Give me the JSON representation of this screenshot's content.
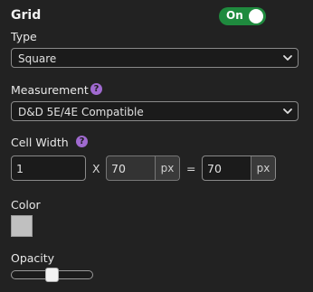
{
  "grid": {
    "title": "Grid",
    "toggle_label": "On",
    "enabled": true
  },
  "type": {
    "label": "Type",
    "value": "Square"
  },
  "measurement": {
    "label": "Measurement",
    "help": "?",
    "value": "D&D 5E/4E Compatible"
  },
  "cell_width": {
    "label": "Cell Width",
    "help": "?",
    "cells_value": "1",
    "times": "X",
    "px_value": "70",
    "unit": "px",
    "equals": "=",
    "result_value": "70",
    "result_unit": "px"
  },
  "color": {
    "label": "Color",
    "swatch_hex": "#c0c0c0"
  },
  "opacity": {
    "label": "Opacity",
    "value_fraction": 0.5
  },
  "colors": {
    "background": "#222222",
    "toggle_on": "#1f8a3e",
    "help_badge": "#a06ad0"
  },
  "icons": {
    "select_arrow": "chevron-down-icon",
    "help": "help-circle-icon"
  }
}
